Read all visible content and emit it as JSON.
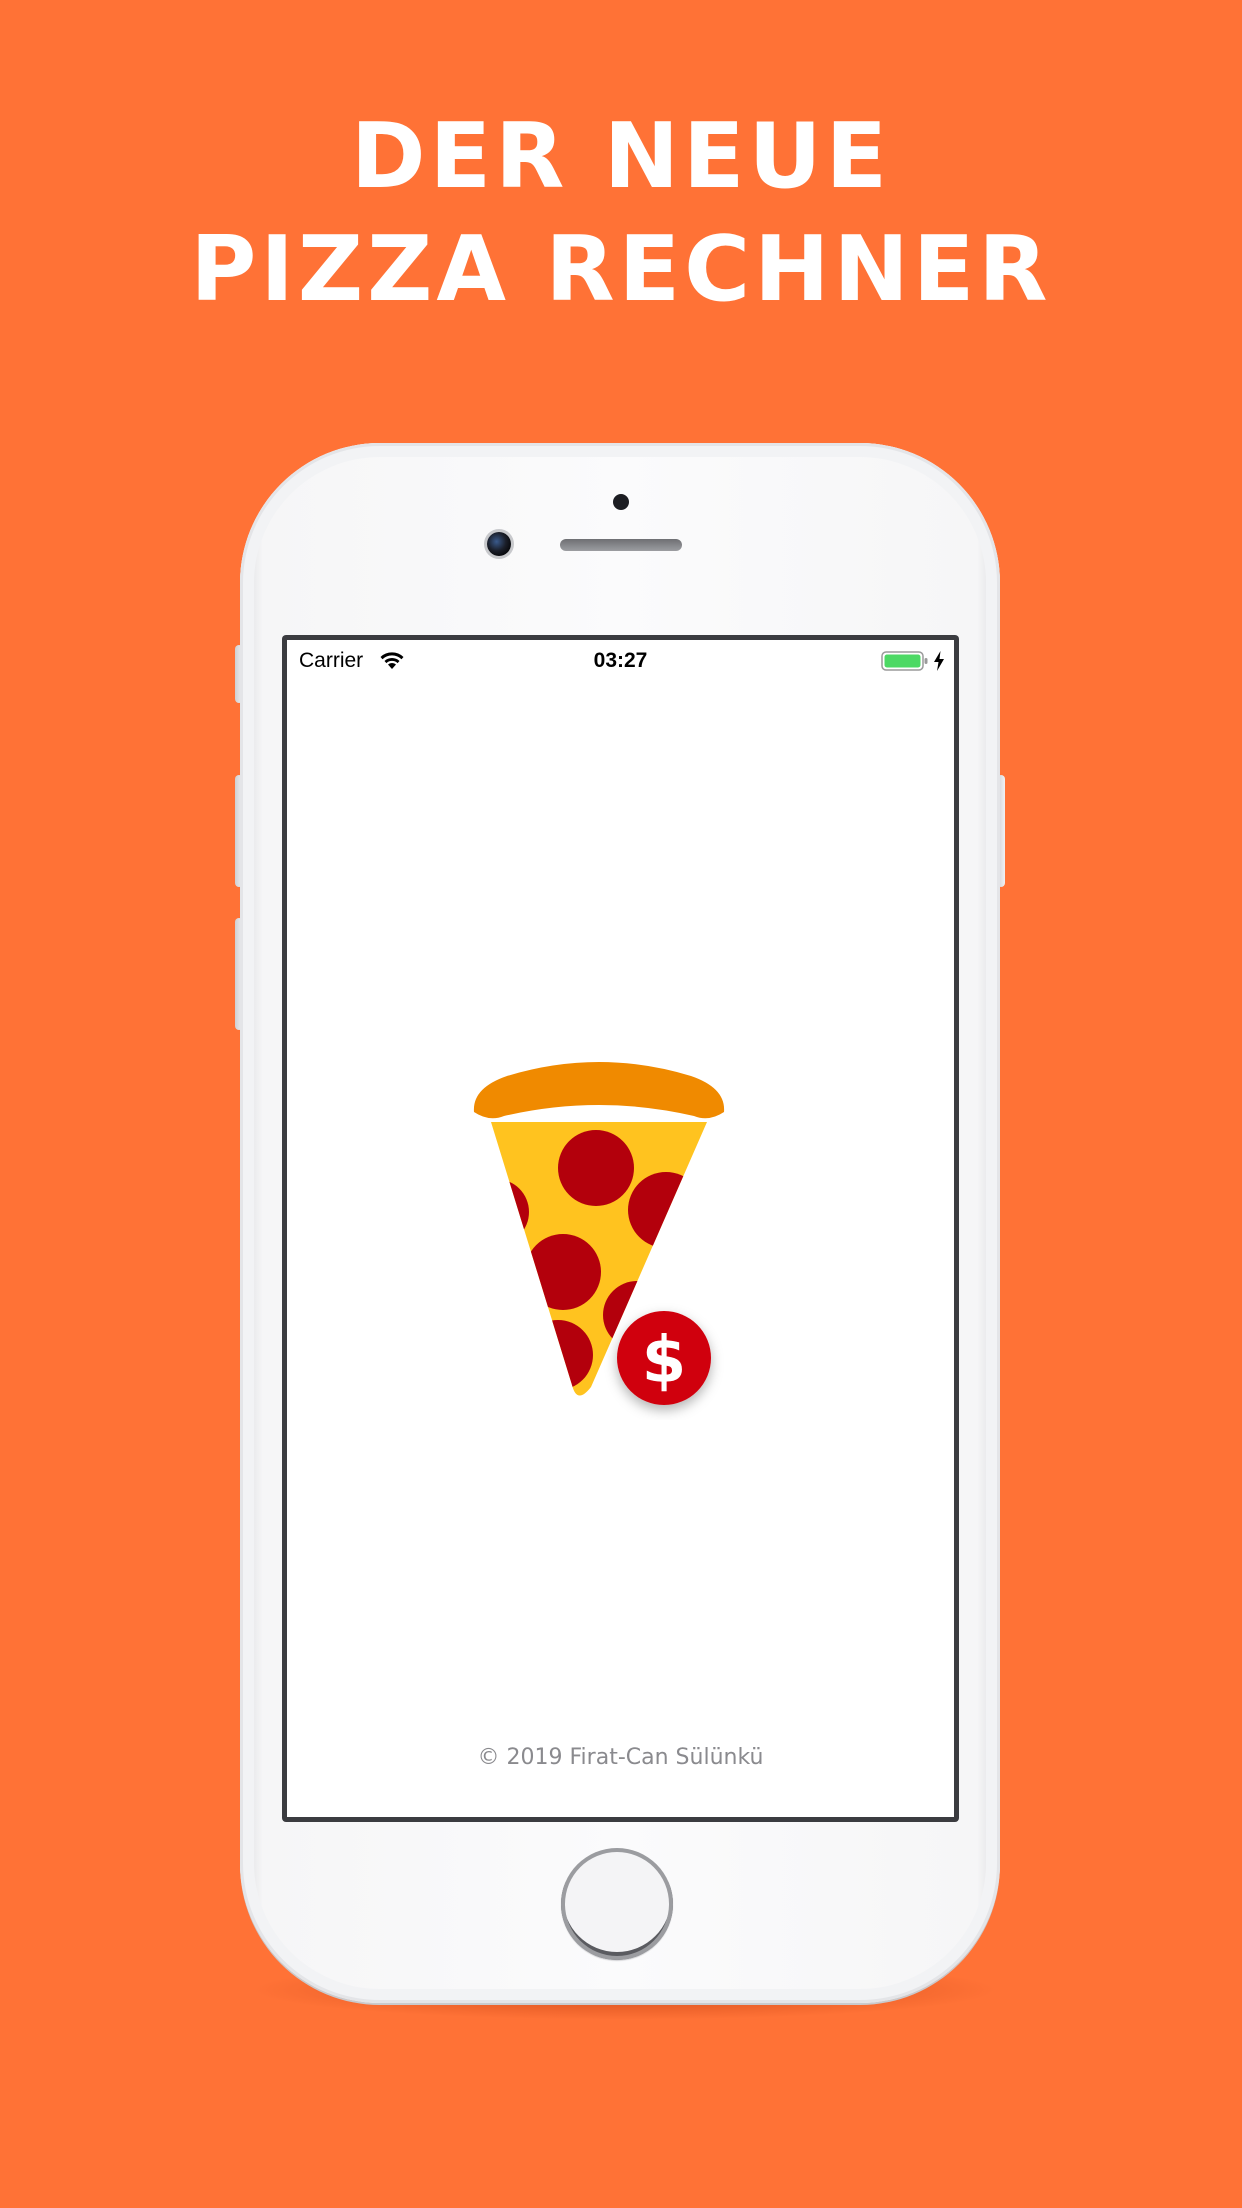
{
  "headline": {
    "line1": "DER NEUE",
    "line2": "PIZZA RECHNER"
  },
  "statusbar": {
    "carrier": "Carrier",
    "time": "03:27",
    "battery_color": "#4CD964"
  },
  "app": {
    "logo_icon": "pizza-slice-dollar-icon",
    "copyright": "© 2019 Firat-Can Sülünkü"
  },
  "colors": {
    "background": "#FF7236",
    "crust": "#F08A00",
    "cheese": "#FFC31F",
    "pepperoni": "#B3000C",
    "coin": "#D0000E"
  }
}
